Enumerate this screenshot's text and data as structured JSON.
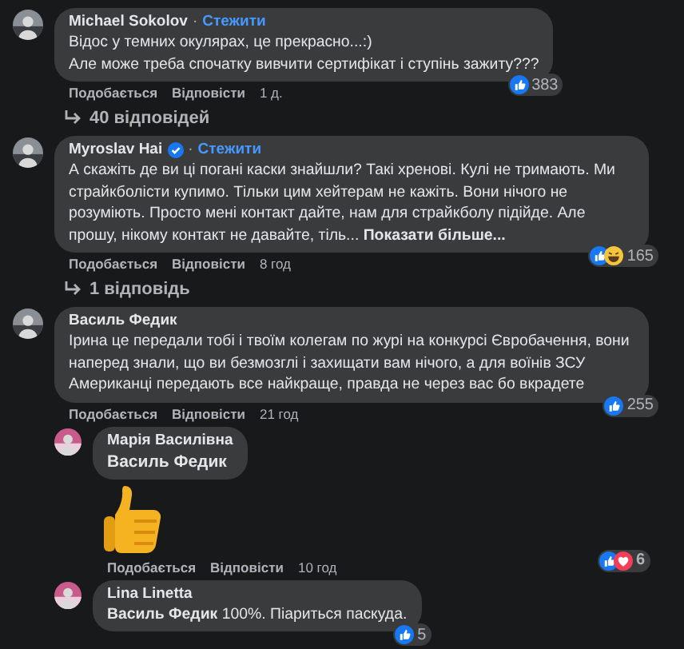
{
  "comments": [
    {
      "author": "Michael Sokolov",
      "follow_separator": "·",
      "follow": "Стежити",
      "text": "Відос у темних окулярах, це прекрасно...:)\nАле може треба спочатку вивчити сертифікат і ступінь зажиту???",
      "reactions": [
        {
          "kind": "like"
        }
      ],
      "reaction_count": "383",
      "like_action": "Подобається",
      "reply_action": "Відповісти",
      "time": "1 д.",
      "replies_link": "40 відповідей"
    },
    {
      "author": "Myroslav Hai",
      "verified": true,
      "follow_separator": "·",
      "follow": "Стежити",
      "text": "А скажіть де ви ці погані каски знайшли? Такі хренові. Кулі не тримають. Ми страйкболісти купимо. Тільки цим хейтерам не кажіть. Вони нічого не розуміють. Просто мені контакт дайте, нам для страйкболу підійде. Але прошу, нікому контакт не давайте, тіль...",
      "show_more": "Показати більше...",
      "reactions": [
        {
          "kind": "like"
        },
        {
          "kind": "haha"
        }
      ],
      "reaction_count": "165",
      "like_action": "Подобається",
      "reply_action": "Відповісти",
      "time": "8 год",
      "replies_link": "1 відповідь"
    },
    {
      "author": "Василь Федик",
      "text": "Ірина це передали тобі і твоїм колегам по журі на конкурсі Євробачення, вони наперед знали, що ви безмозглі і захищати вам нічого, а для воїнів ЗСУ Американці передають все найкраще, правда не через вас бо вкрадете",
      "reactions": [
        {
          "kind": "like"
        }
      ],
      "reaction_count": "255",
      "like_action": "Подобається",
      "reply_action": "Відповісти",
      "time": "21 год",
      "replies": [
        {
          "author": "Марія Василівна",
          "mention": "Василь Федик",
          "sticker": {
            "kind": "thumbs_up"
          },
          "reactions": [
            {
              "kind": "like"
            },
            {
              "kind": "love"
            }
          ],
          "reaction_count": "6",
          "like_action": "Подобається",
          "reply_action": "Відповісти",
          "time": "10 год"
        },
        {
          "author": "Lina Linetta",
          "mention": "Василь Федик",
          "text": "100%. Піариться паскуда.",
          "reactions": [
            {
              "kind": "like"
            }
          ],
          "reaction_count": "5"
        }
      ]
    }
  ]
}
